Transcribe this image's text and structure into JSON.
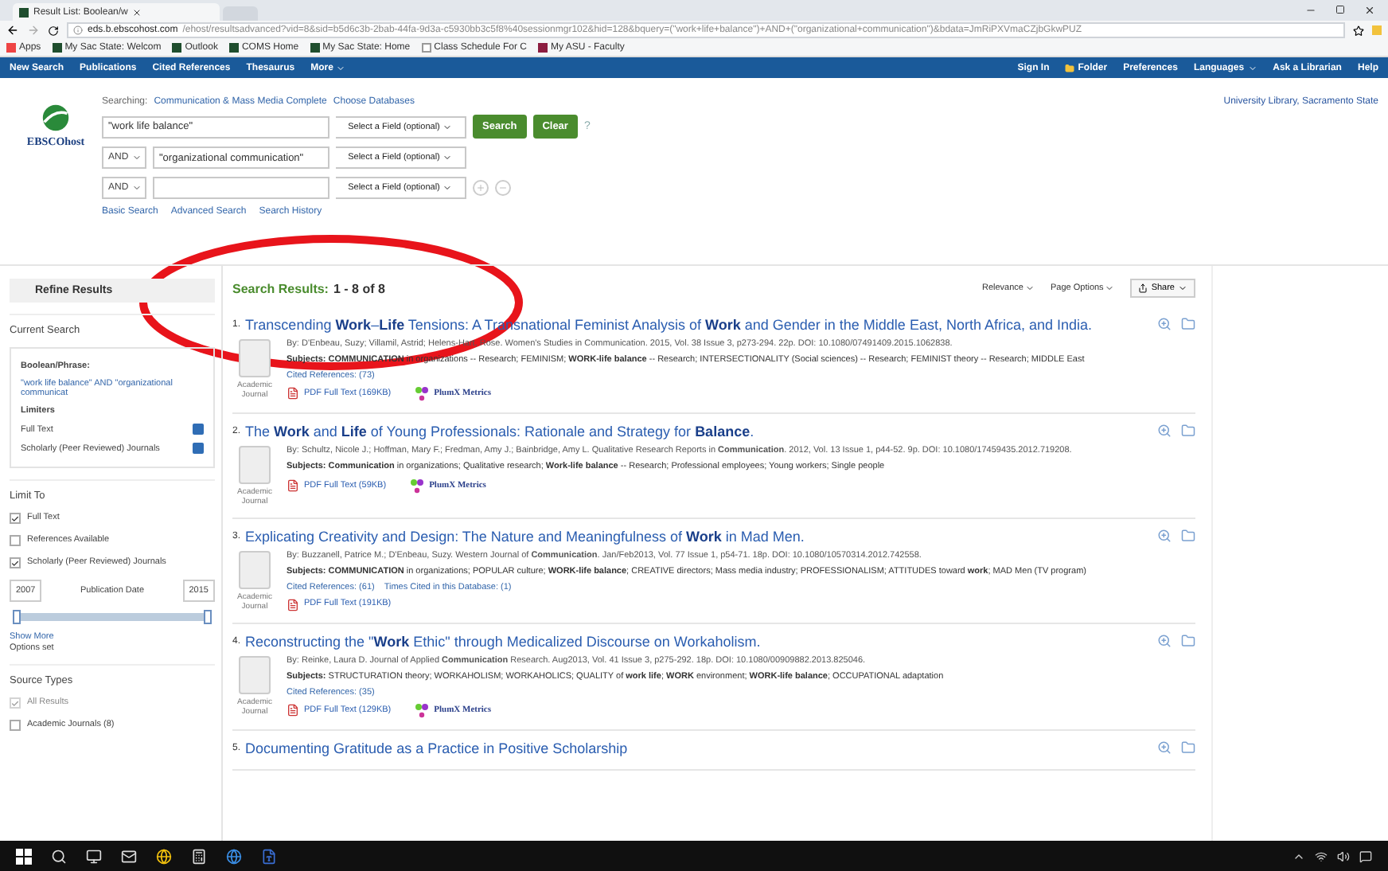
{
  "browser": {
    "tab_title": "Result List: Boolean/w",
    "url_host": "eds.b.ebscohost.com",
    "url_path": "/ehost/resultsadvanced?vid=8&sid=b5d6c3b-2bab-44fa-9d3a-c5930bb3c5f8%40sessionmgr102&hid=128&bquery=(\"work+life+balance\")+AND+(\"organizational+communication\")&bdata=JmRiPXVmaCZjbGkwPUZ",
    "bookmarks": [
      {
        "label": "Apps",
        "kind": "apps"
      },
      {
        "label": "My Sac State: Welcom",
        "kind": "site"
      },
      {
        "label": "Outlook",
        "kind": "site"
      },
      {
        "label": "COMS Home",
        "kind": "site"
      },
      {
        "label": "My Sac State: Home",
        "kind": "site"
      },
      {
        "label": "Class Schedule For C",
        "kind": "page"
      },
      {
        "label": "My ASU - Faculty",
        "kind": "asu"
      }
    ]
  },
  "nav": {
    "left": [
      {
        "label": "New Search",
        "dropdown": false
      },
      {
        "label": "Publications",
        "dropdown": false
      },
      {
        "label": "Cited References",
        "dropdown": false
      },
      {
        "label": "Thesaurus",
        "dropdown": false
      },
      {
        "label": "More",
        "dropdown": true
      }
    ],
    "right": [
      {
        "label": "Sign In",
        "kind": "link"
      },
      {
        "label": "Folder",
        "kind": "folder"
      },
      {
        "label": "Preferences",
        "kind": "link"
      },
      {
        "label": "Languages",
        "kind": "dropdown"
      },
      {
        "label": "Ask a Librarian",
        "kind": "link"
      },
      {
        "label": "Help",
        "kind": "link"
      }
    ]
  },
  "logo_text": "EBSCOhost",
  "search": {
    "searching_label": "Searching:",
    "database": "Communication & Mass Media Complete",
    "choose_link": "Choose Databases",
    "rows": [
      {
        "value": "\"work life balance\"",
        "field": "Select a Field (optional)",
        "kind": "first"
      },
      {
        "operator": "AND",
        "value": "\"organizational communication\"",
        "field": "Select a Field (optional)",
        "kind": "middle"
      },
      {
        "operator": "AND",
        "field": "Select a Field (optional)",
        "kind": "last"
      }
    ],
    "search_button": "Search",
    "clear_button": "Clear",
    "help_mark": "?",
    "links": [
      "Basic Search",
      "Advanced Search",
      "Search History"
    ]
  },
  "institution": "University Library, Sacramento State",
  "sidebar": {
    "title": "Refine Results",
    "current_search": {
      "title": "Current Search",
      "boolean_label": "Boolean/Phrase:",
      "boolean_value": "\"work life balance\" AND \"organizational communicat",
      "limiters_label": "Limiters",
      "limiters": [
        "Full Text",
        "Scholarly (Peer Reviewed) Journals"
      ]
    },
    "limit_to": {
      "title": "Limit To",
      "options": [
        {
          "label": "Full Text",
          "checked": true
        },
        {
          "label": "References Available",
          "checked": false
        },
        {
          "label": "Scholarly (Peer Reviewed) Journals",
          "checked": true
        }
      ],
      "date_from": "2007",
      "date_label": "Publication Date",
      "date_to": "2015",
      "level": 1,
      "show_more": "Show More",
      "options_set": "Options set"
    },
    "source_types": {
      "title": "Source Types",
      "options": [
        {
          "label": "All Results",
          "checked": true,
          "disabled": true
        },
        {
          "label": "Academic Journals (8)",
          "checked": false,
          "disabled": false
        }
      ]
    }
  },
  "results": {
    "summary_label": "Search Results:",
    "summary_range": "1 - 8 of 8",
    "tools": [
      {
        "label": "Relevance",
        "kind": "link"
      },
      {
        "label": "Page Options",
        "kind": "link"
      },
      {
        "label": "Share",
        "kind": "button"
      }
    ],
    "items": [
      {
        "number": "1.",
        "title": "Transcending **Work**–**Life** Tensions: A Transnational Feminist Analysis of **Work** and Gender in the Middle East, North Africa, and India.",
        "byline": "By: D'Enbeau, Suzy; Villamil, Astrid; Helens-Hart, Rose. Women's Studies in Communication. 2015, Vol. 38 Issue 3, p273-294. 22p. DOI: 10.1080/07491409.2015.1062838.",
        "subjects": "**Subjects: COMMUNICATION** in organizations -- Research; FEMINISM; **WORK-life balance** -- Research; INTERSECTIONALITY (Social sciences) -- Research; FEMINIST theory -- Research; MIDDLE East",
        "doc_type": "Academic Journal",
        "links": [
          "Cited References: (73)"
        ],
        "pdf": "PDF Full Text (169KB)",
        "plumx": "PlumX Metrics"
      },
      {
        "number": "2.",
        "title": "The **Work** and **Life** of Young Professionals: Rationale and Strategy for **Balance**.",
        "byline": "By: Schultz, Nicole J.; Hoffman, Mary F.; Fredman, Amy J.; Bainbridge, Amy L. Qualitative Research Reports in **Communication**. 2012, Vol. 13 Issue 1, p44-52. 9p. DOI: 10.1080/17459435.2012.719208.",
        "subjects": "**Subjects: Communication** in organizations; Qualitative research; **Work-life balance** -- Research; Professional employees; Young workers; Single people",
        "doc_type": "Academic Journal",
        "pdf": "PDF Full Text (59KB)",
        "plumx": "PlumX Metrics"
      },
      {
        "number": "3.",
        "title": "Explicating Creativity and Design: The Nature and Meaningfulness of **Work** in Mad Men.",
        "byline": "By: Buzzanell, Patrice M.; D'Enbeau, Suzy. Western Journal of **Communication**. Jan/Feb2013, Vol. 77 Issue 1, p54-71. 18p. DOI: 10.1080/10570314.2012.742558.",
        "subjects": "**Subjects: COMMUNICATION** in organizations; POPULAR culture; **WORK-life balance**; CREATIVE directors; Mass media industry; PROFESSIONALISM; ATTITUDES toward **work**; MAD Men (TV program)",
        "doc_type": "Academic Journal",
        "links": [
          "Cited References: (61)",
          "Times Cited in this Database: (1)"
        ],
        "pdf": "PDF Full Text (191KB)"
      },
      {
        "number": "4.",
        "title": "Reconstructing the \"**Work** Ethic\" through Medicalized Discourse on Workaholism.",
        "byline": "By: Reinke, Laura D. Journal of Applied **Communication** Research. Aug2013, Vol. 41 Issue 3, p275-292. 18p. DOI: 10.1080/00909882.2013.825046.",
        "subjects": "**Subjects:** STRUCTURATION theory; WORKAHOLISM; WORKAHOLICS; QUALITY of **work life**; **WORK** environment; **WORK-life balance**; OCCUPATIONAL adaptation",
        "doc_type": "Academic Journal",
        "links": [
          "Cited References: (35)"
        ],
        "pdf": "PDF Full Text (129KB)",
        "plumx": "PlumX Metrics"
      },
      {
        "number": "5.",
        "title": "Documenting Gratitude as a Practice in Positive Scholarship"
      }
    ]
  },
  "annotation": {
    "kind": "ellipse",
    "color": "#e8141b"
  }
}
